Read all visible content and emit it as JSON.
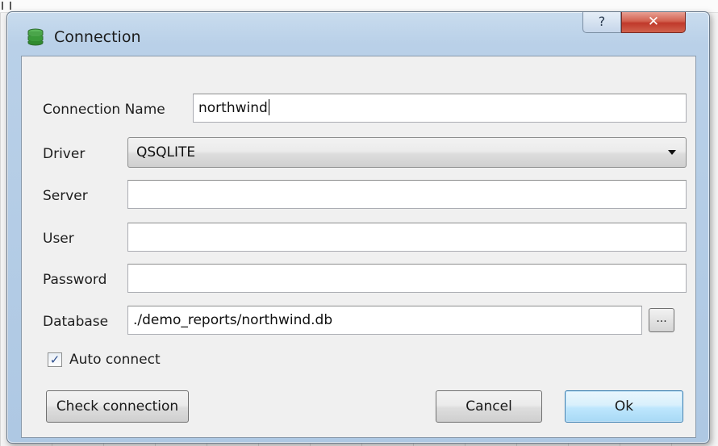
{
  "window": {
    "title": "Connection",
    "help_glyph": "?",
    "close_glyph": "✕",
    "icon": "database-icon"
  },
  "form": {
    "connection_name": {
      "label": "Connection Name",
      "value": "northwind"
    },
    "driver": {
      "label": "Driver",
      "value": "QSQLITE"
    },
    "server": {
      "label": "Server",
      "value": ""
    },
    "user": {
      "label": "User",
      "value": ""
    },
    "password": {
      "label": "Password",
      "value": ""
    },
    "database": {
      "label": "Database",
      "value": "./demo_reports/northwind.db",
      "browse_label": "..."
    },
    "auto_connect": {
      "label": "Auto connect",
      "checked": true,
      "check_glyph": "✓"
    }
  },
  "buttons": {
    "check_connection": "Check connection",
    "cancel": "Cancel",
    "ok": "Ok"
  },
  "colors": {
    "window_frame": "#b9d0e8",
    "close_button": "#c0392b",
    "default_button_border": "#3c7fb1",
    "icon_green": "#3a9a3a"
  }
}
